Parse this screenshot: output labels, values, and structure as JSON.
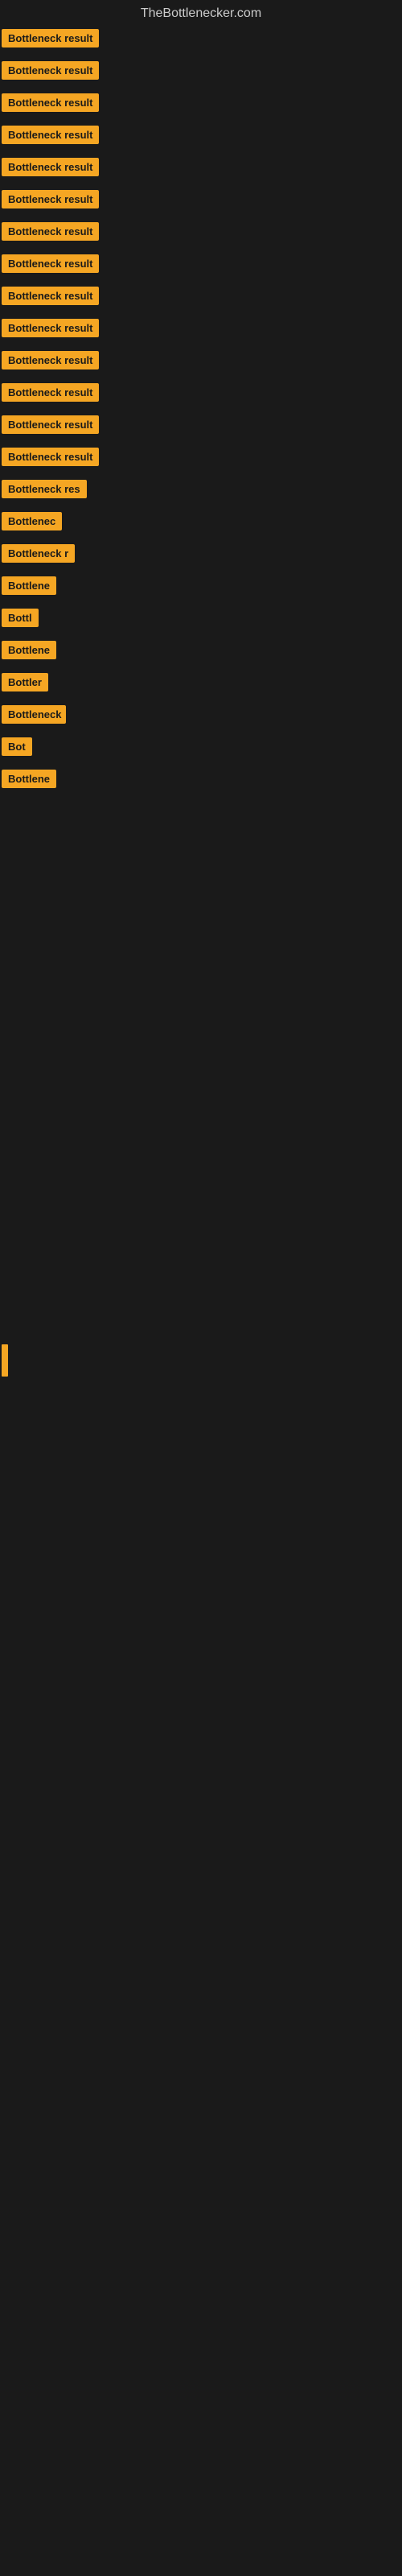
{
  "site": {
    "title": "TheBottlenecker.com"
  },
  "colors": {
    "badge_bg": "#f5a623",
    "badge_text": "#1a1a1a",
    "page_bg": "#1a1a1a",
    "title_text": "#cccccc"
  },
  "rows": [
    {
      "id": 1,
      "label": "Bottleneck result",
      "class": "row-1"
    },
    {
      "id": 2,
      "label": "Bottleneck result",
      "class": "row-2"
    },
    {
      "id": 3,
      "label": "Bottleneck result",
      "class": "row-3"
    },
    {
      "id": 4,
      "label": "Bottleneck result",
      "class": "row-4"
    },
    {
      "id": 5,
      "label": "Bottleneck result",
      "class": "row-5"
    },
    {
      "id": 6,
      "label": "Bottleneck result",
      "class": "row-6"
    },
    {
      "id": 7,
      "label": "Bottleneck result",
      "class": "row-7"
    },
    {
      "id": 8,
      "label": "Bottleneck result",
      "class": "row-8"
    },
    {
      "id": 9,
      "label": "Bottleneck result",
      "class": "row-9"
    },
    {
      "id": 10,
      "label": "Bottleneck result",
      "class": "row-10"
    },
    {
      "id": 11,
      "label": "Bottleneck result",
      "class": "row-11"
    },
    {
      "id": 12,
      "label": "Bottleneck result",
      "class": "row-12"
    },
    {
      "id": 13,
      "label": "Bottleneck result",
      "class": "row-13"
    },
    {
      "id": 14,
      "label": "Bottleneck result",
      "class": "row-14"
    },
    {
      "id": 15,
      "label": "Bottleneck res",
      "class": "row-15"
    },
    {
      "id": 16,
      "label": "Bottlenec",
      "class": "row-16"
    },
    {
      "id": 17,
      "label": "Bottleneck r",
      "class": "row-17"
    },
    {
      "id": 18,
      "label": "Bottlene",
      "class": "row-18"
    },
    {
      "id": 19,
      "label": "Bottl",
      "class": "row-19"
    },
    {
      "id": 20,
      "label": "Bottlene",
      "class": "row-20"
    },
    {
      "id": 21,
      "label": "Bottler",
      "class": "row-21"
    },
    {
      "id": 22,
      "label": "Bottleneck",
      "class": "row-22"
    },
    {
      "id": 23,
      "label": "Bot",
      "class": "row-23"
    },
    {
      "id": 24,
      "label": "Bottlene",
      "class": "row-24"
    }
  ]
}
